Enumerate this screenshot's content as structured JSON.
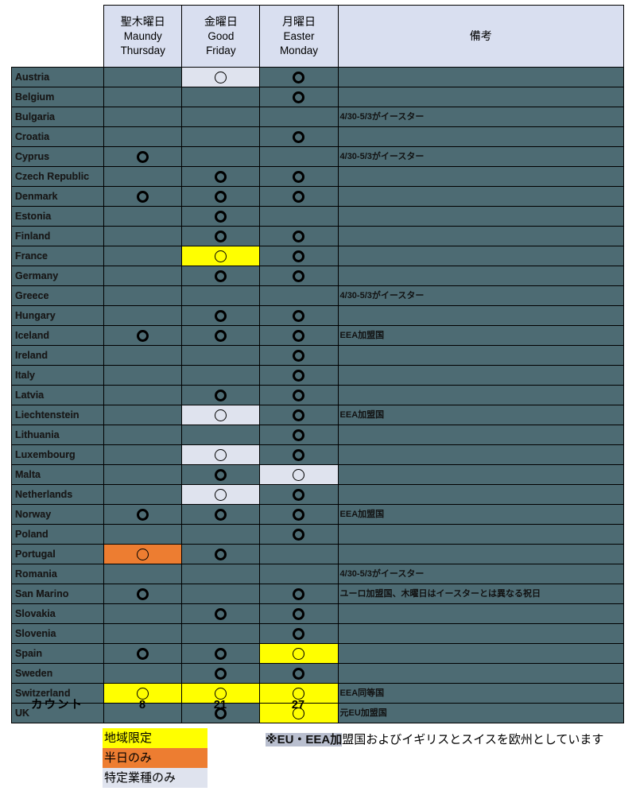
{
  "table": {
    "columns": [
      {
        "key": "country",
        "label": ""
      },
      {
        "key": "maundy",
        "jp": "聖木曜日",
        "en1": "Maundy",
        "en2": "Thursday"
      },
      {
        "key": "good",
        "jp": "金曜日",
        "en1": "Good",
        "en2": "Friday"
      },
      {
        "key": "easter",
        "jp": "月曜日",
        "en1": "Easter",
        "en2": "Monday"
      },
      {
        "key": "remark",
        "label": "備考"
      }
    ],
    "rows": [
      {
        "country": "Austria",
        "maundy": "",
        "maundy_hl": "",
        "good": "○",
        "good_hl": "gray",
        "easter": "○",
        "easter_hl": "",
        "remark": ""
      },
      {
        "country": "Belgium",
        "maundy": "",
        "maundy_hl": "",
        "good": "",
        "good_hl": "",
        "easter": "○",
        "easter_hl": "",
        "remark": ""
      },
      {
        "country": "Bulgaria",
        "maundy": "",
        "maundy_hl": "",
        "good": "",
        "good_hl": "",
        "easter": "",
        "easter_hl": "",
        "remark": "4/30-5/3がイースター"
      },
      {
        "country": "Croatia",
        "maundy": "",
        "maundy_hl": "",
        "good": "",
        "good_hl": "",
        "easter": "○",
        "easter_hl": "",
        "remark": ""
      },
      {
        "country": "Cyprus",
        "maundy": "○",
        "maundy_hl": "",
        "good": "",
        "good_hl": "",
        "easter": "",
        "easter_hl": "",
        "remark": "4/30-5/3がイースター"
      },
      {
        "country": "Czech Republic",
        "maundy": "",
        "maundy_hl": "",
        "good": "○",
        "good_hl": "",
        "easter": "○",
        "easter_hl": "",
        "remark": ""
      },
      {
        "country": "Denmark",
        "maundy": "○",
        "maundy_hl": "",
        "good": "○",
        "good_hl": "",
        "easter": "○",
        "easter_hl": "",
        "remark": ""
      },
      {
        "country": "Estonia",
        "maundy": "",
        "maundy_hl": "",
        "good": "○",
        "good_hl": "",
        "easter": "",
        "easter_hl": "",
        "remark": ""
      },
      {
        "country": "Finland",
        "maundy": "",
        "maundy_hl": "",
        "good": "○",
        "good_hl": "",
        "easter": "○",
        "easter_hl": "",
        "remark": ""
      },
      {
        "country": "France",
        "maundy": "",
        "maundy_hl": "",
        "good": "○",
        "good_hl": "yellow",
        "easter": "○",
        "easter_hl": "",
        "remark": ""
      },
      {
        "country": "Germany",
        "maundy": "",
        "maundy_hl": "",
        "good": "○",
        "good_hl": "",
        "easter": "○",
        "easter_hl": "",
        "remark": ""
      },
      {
        "country": "Greece",
        "maundy": "",
        "maundy_hl": "",
        "good": "",
        "good_hl": "",
        "easter": "",
        "easter_hl": "",
        "remark": "4/30-5/3がイースター"
      },
      {
        "country": "Hungary",
        "maundy": "",
        "maundy_hl": "",
        "good": "○",
        "good_hl": "",
        "easter": "○",
        "easter_hl": "",
        "remark": ""
      },
      {
        "country": "Iceland",
        "maundy": "○",
        "maundy_hl": "",
        "good": "○",
        "good_hl": "",
        "easter": "○",
        "easter_hl": "",
        "remark": "EEA加盟国"
      },
      {
        "country": "Ireland",
        "maundy": "",
        "maundy_hl": "",
        "good": "",
        "good_hl": "",
        "easter": "○",
        "easter_hl": "",
        "remark": ""
      },
      {
        "country": "Italy",
        "maundy": "",
        "maundy_hl": "",
        "good": "",
        "good_hl": "",
        "easter": "○",
        "easter_hl": "",
        "remark": ""
      },
      {
        "country": "Latvia",
        "maundy": "",
        "maundy_hl": "",
        "good": "○",
        "good_hl": "",
        "easter": "○",
        "easter_hl": "",
        "remark": ""
      },
      {
        "country": "Liechtenstein",
        "maundy": "",
        "maundy_hl": "",
        "good": "○",
        "good_hl": "gray",
        "easter": "○",
        "easter_hl": "",
        "remark": "EEA加盟国"
      },
      {
        "country": "Lithuania",
        "maundy": "",
        "maundy_hl": "",
        "good": "",
        "good_hl": "",
        "easter": "○",
        "easter_hl": "",
        "remark": ""
      },
      {
        "country": "Luxembourg",
        "maundy": "",
        "maundy_hl": "",
        "good": "○",
        "good_hl": "gray",
        "easter": "○",
        "easter_hl": "",
        "remark": ""
      },
      {
        "country": "Malta",
        "maundy": "",
        "maundy_hl": "",
        "good": "○",
        "good_hl": "",
        "easter": "○",
        "easter_hl": "gray",
        "remark": ""
      },
      {
        "country": "Netherlands",
        "maundy": "",
        "maundy_hl": "",
        "good": "○",
        "good_hl": "gray",
        "easter": "○",
        "easter_hl": "",
        "remark": ""
      },
      {
        "country": "Norway",
        "maundy": "○",
        "maundy_hl": "",
        "good": "○",
        "good_hl": "",
        "easter": "○",
        "easter_hl": "",
        "remark": "EEA加盟国"
      },
      {
        "country": "Poland",
        "maundy": "",
        "maundy_hl": "",
        "good": "",
        "good_hl": "",
        "easter": "○",
        "easter_hl": "",
        "remark": ""
      },
      {
        "country": "Portugal",
        "maundy": "○",
        "maundy_hl": "orange",
        "good": "○",
        "good_hl": "",
        "easter": "",
        "easter_hl": "",
        "remark": ""
      },
      {
        "country": "Romania",
        "maundy": "",
        "maundy_hl": "",
        "good": "",
        "good_hl": "",
        "easter": "",
        "easter_hl": "",
        "remark": "4/30-5/3がイースター"
      },
      {
        "country": "San Marino",
        "maundy": "○",
        "maundy_hl": "",
        "good": "",
        "good_hl": "",
        "easter": "○",
        "easter_hl": "",
        "remark": "ユーロ加盟国、木曜日はイースターとは異なる祝日"
      },
      {
        "country": "Slovakia",
        "maundy": "",
        "maundy_hl": "",
        "good": "○",
        "good_hl": "",
        "easter": "○",
        "easter_hl": "",
        "remark": ""
      },
      {
        "country": "Slovenia",
        "maundy": "",
        "maundy_hl": "",
        "good": "",
        "good_hl": "",
        "easter": "○",
        "easter_hl": "",
        "remark": ""
      },
      {
        "country": "Spain",
        "maundy": "○",
        "maundy_hl": "",
        "good": "○",
        "good_hl": "",
        "easter": "○",
        "easter_hl": "yellow",
        "remark": ""
      },
      {
        "country": "Sweden",
        "maundy": "",
        "maundy_hl": "",
        "good": "○",
        "good_hl": "",
        "easter": "○",
        "easter_hl": "",
        "remark": ""
      },
      {
        "country": "Switzerland",
        "maundy": "○",
        "maundy_hl": "yellow",
        "good": "○",
        "good_hl": "yellow",
        "easter": "○",
        "easter_hl": "yellow",
        "remark": "EEA同等国"
      },
      {
        "country": "UK",
        "maundy": "",
        "maundy_hl": "",
        "good": "○",
        "good_hl": "",
        "easter": "○",
        "easter_hl": "yellow",
        "remark": "元EU加盟国"
      }
    ]
  },
  "counts": {
    "label": "カウント",
    "maundy": "8",
    "good": "21",
    "easter": "27"
  },
  "legend": [
    {
      "label": "地域限定",
      "color": "#ffff00",
      "cls": "lg-yellow"
    },
    {
      "label": "半日のみ",
      "color": "#ed7d31",
      "cls": "lg-orange"
    },
    {
      "label": "特定業種のみ",
      "color": "#dfe3ee",
      "cls": "lg-gray"
    }
  ],
  "footnote": {
    "highlight": "※EU・EEA加",
    "rest": "盟国およびイギリスとスイスを欧州としています"
  },
  "colors": {
    "cell_bg": "#4d6b73",
    "header_bg": "#d9dff0",
    "yellow": "#ffff00",
    "orange": "#ed7d31",
    "gray": "#dfe3ee",
    "border": "#000000"
  }
}
